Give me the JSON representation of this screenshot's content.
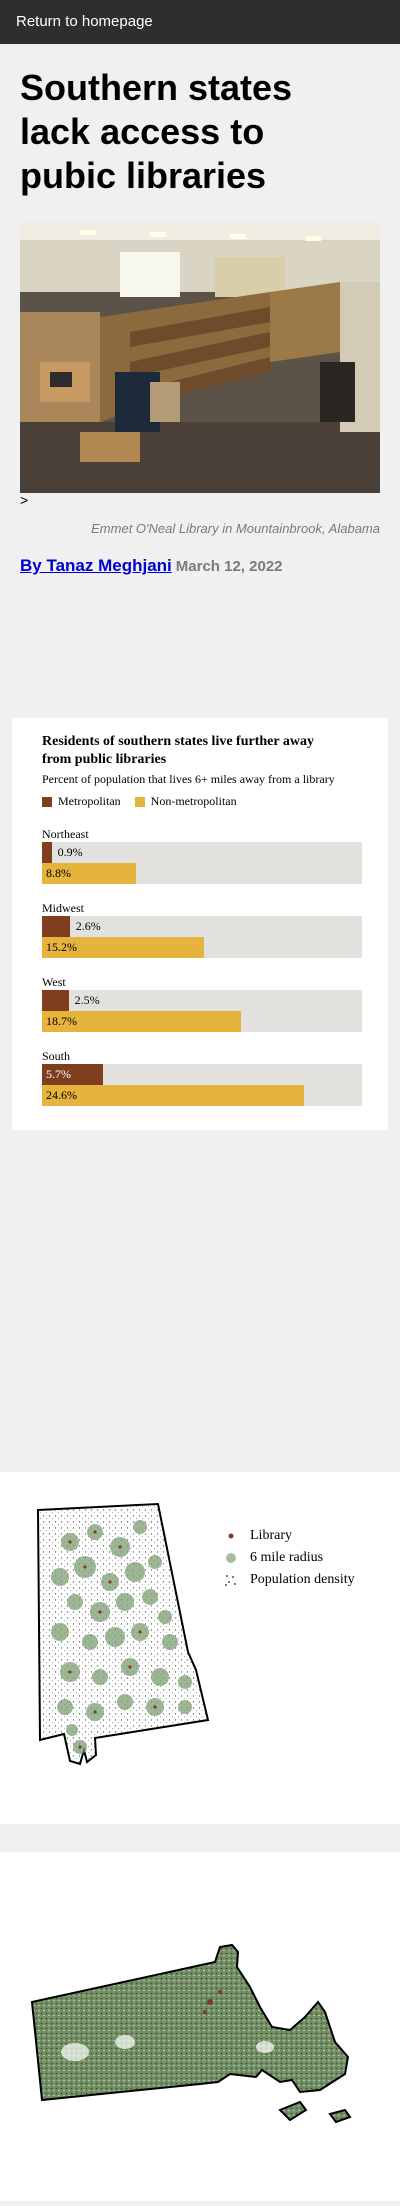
{
  "nav": {
    "home_link": "Return to homepage"
  },
  "article": {
    "headline": "Southern states lack access to pubic libraries",
    "stray_char": ">",
    "photo_caption": "Emmet O'Neal Library in Mountainbrook, Alabama",
    "author": "By Tanaz Meghjani",
    "date": "March 12, 2022"
  },
  "colors": {
    "metro": "#7f3f1f",
    "nonmetro": "#e6b33d",
    "track": "#e3e1dd"
  },
  "chart_data": {
    "type": "bar",
    "title": "Residents of southern states live further away from public libraries",
    "subtitle": "Percent of population that lives 6+ miles away from a library",
    "xlim": [
      0,
      30
    ],
    "categories": [
      "Northeast",
      "Midwest",
      "West",
      "South"
    ],
    "series": [
      {
        "name": "Metropolitan",
        "values": [
          0.9,
          2.6,
          2.5,
          5.7
        ],
        "labels": [
          "0.9%",
          "2.6%",
          "2.5%",
          "5.7%"
        ]
      },
      {
        "name": "Non-metropolitan",
        "values": [
          8.8,
          15.2,
          18.7,
          24.6
        ],
        "labels": [
          "8.8%",
          "15.2%",
          "18.7%",
          "24.6%"
        ]
      }
    ]
  },
  "map_legend": {
    "library": "Library",
    "radius": "6 mile radius",
    "density": "Population density"
  }
}
